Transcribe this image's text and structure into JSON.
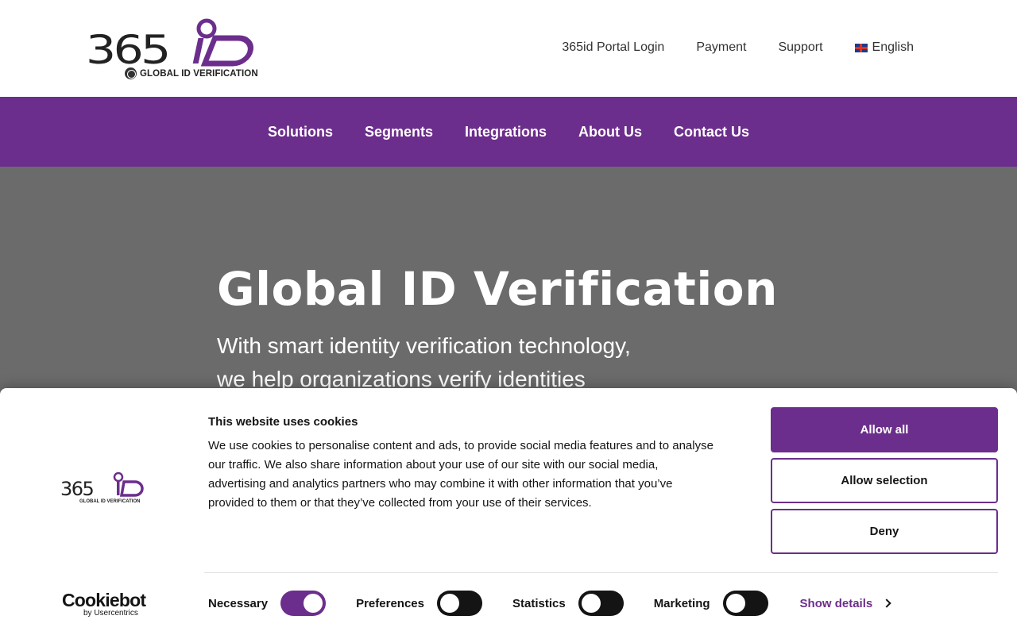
{
  "header": {
    "logo_text": "365iD",
    "logo_tagline": "GLOBAL ID VERIFICATION",
    "util_links": [
      "365id Portal Login",
      "Payment",
      "Support"
    ],
    "language": "English"
  },
  "main_nav": {
    "items": [
      "Solutions",
      "Segments",
      "Integrations",
      "About Us",
      "Contact Us"
    ]
  },
  "hero": {
    "title": "Global ID Verification",
    "subtitle_line1": "With smart identity verification technology,",
    "subtitle_line2": "we help organizations verify identities"
  },
  "cookie_banner": {
    "title": "This website uses cookies",
    "body": "We use cookies to personalise content and ads, to provide social media features and to analyse our traffic. We also share information about your use of our site with our social media, advertising and analytics partners who may combine it with other information that you’ve provided to them or that they’ve collected from your use of their services.",
    "buttons": {
      "allow_all": "Allow all",
      "allow_selection": "Allow selection",
      "deny": "Deny"
    },
    "toggles": [
      {
        "label": "Necessary",
        "on": true
      },
      {
        "label": "Preferences",
        "on": false
      },
      {
        "label": "Statistics",
        "on": false
      },
      {
        "label": "Marketing",
        "on": false
      }
    ],
    "show_details": "Show details",
    "powered_by": {
      "brand": "Cookiebot",
      "by": "by Usercentrics"
    }
  },
  "colors": {
    "brand_purple": "#6c2e8c",
    "hero_bg": "#6b6b6b",
    "text_dark": "#141414"
  }
}
